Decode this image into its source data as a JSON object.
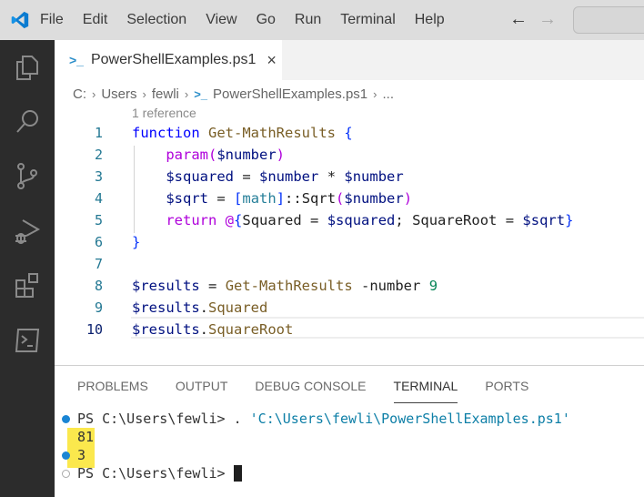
{
  "menubar": {
    "items": [
      "File",
      "Edit",
      "Selection",
      "View",
      "Go",
      "Run",
      "Terminal",
      "Help"
    ]
  },
  "activitybar": {
    "icons": [
      "explorer-icon",
      "search-icon",
      "source-control-icon",
      "run-debug-icon",
      "extensions-icon",
      "terminal-icon"
    ]
  },
  "tab": {
    "label": "PowerShellExamples.ps1",
    "close": "×"
  },
  "breadcrumb": {
    "items": [
      "C:",
      "Users",
      "fewli",
      "PowerShellExamples.ps1",
      "..."
    ]
  },
  "editor": {
    "codelens": "1 reference",
    "line_numbers": [
      "1",
      "2",
      "3",
      "4",
      "5",
      "6",
      "7",
      "8",
      "9",
      "10"
    ],
    "lines": [
      "function Get-MathResults {",
      "    param($number)",
      "    $squared = $number * $number",
      "    $sqrt = [math]::Sqrt($number)",
      "    return @{Squared = $squared; SquareRoot = $sqrt}",
      "}",
      "",
      "$results = Get-MathResults -number 9",
      "$results.Squared",
      "$results.SquareRoot"
    ],
    "current_line": 10
  },
  "panel": {
    "tabs": [
      "PROBLEMS",
      "OUTPUT",
      "DEBUG CONSOLE",
      "TERMINAL",
      "PORTS"
    ],
    "active_tab": "TERMINAL"
  },
  "terminal": {
    "prompt": "PS C:\\Users\\fewli> ",
    "command_dot": ". ",
    "command_path": "'C:\\Users\\fewli\\PowerShellExamples.ps1'",
    "output": [
      "81",
      "3"
    ],
    "highlight_color": "#fbe84d"
  }
}
